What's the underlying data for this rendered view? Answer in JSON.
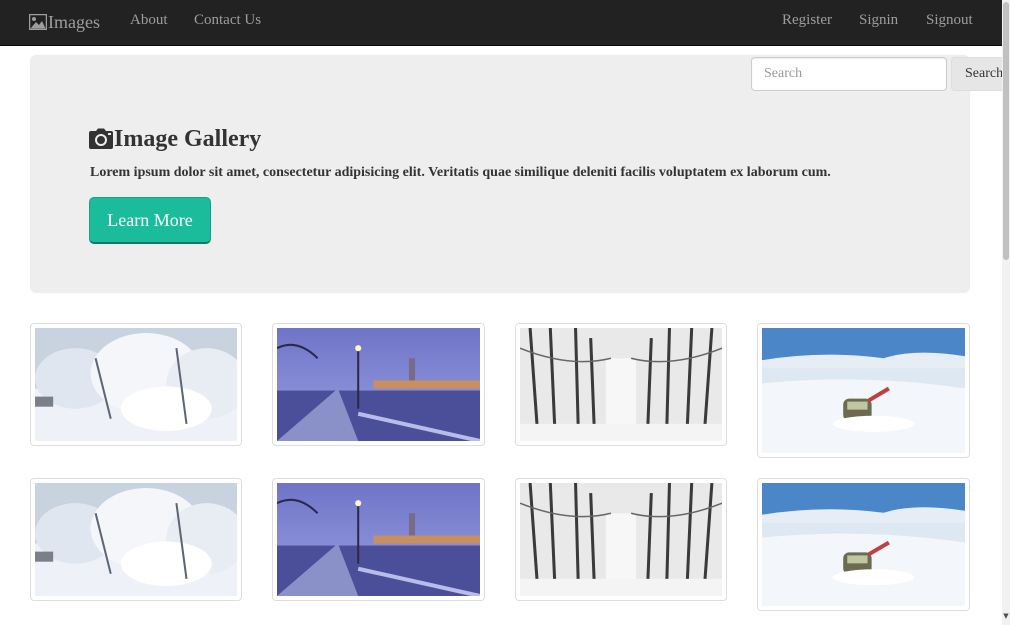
{
  "navbar": {
    "brand_icon": "image-icon",
    "brand_label": "Images",
    "left_links": [
      "About",
      "Contact Us"
    ],
    "right_links": [
      "Register",
      "Signin",
      "Signout"
    ],
    "background": "#222222",
    "link_color": "#9d9d9d"
  },
  "search": {
    "placeholder": "Search",
    "button_label": "Search"
  },
  "jumbotron": {
    "icon": "camera-icon",
    "title": "Image Gallery",
    "text": "Lorem ipsum dolor sit amet, consectetur adipisicing elit. Veritatis quae similique deleniti facilis voluptatem ex laborum cum.",
    "button_label": "Learn More",
    "button_color": "#1abc9c",
    "background": "#eeeeee"
  },
  "gallery": {
    "rows": [
      [
        "snowy-trees",
        "london-winter-night",
        "snowy-forest-path",
        "train-in-snow"
      ],
      [
        "snowy-trees",
        "london-winter-night",
        "snowy-forest-path",
        "train-in-snow"
      ]
    ]
  }
}
